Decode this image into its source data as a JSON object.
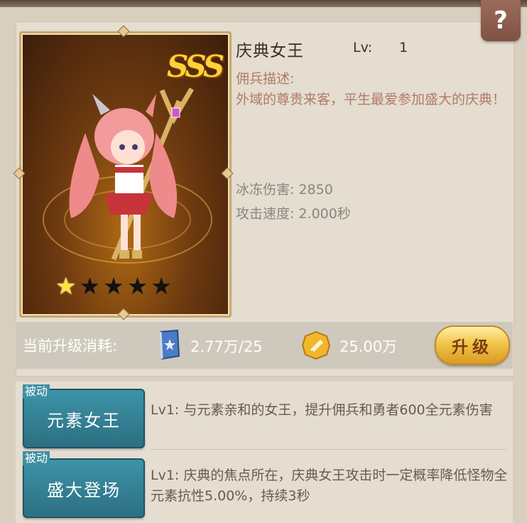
{
  "help_label": "?",
  "hero": {
    "name": "庆典女王",
    "level_label": "Lv:",
    "level_value": "1",
    "grade": "SSS",
    "stars_total": 5,
    "stars_filled": 1,
    "desc_title": "佣兵描述:",
    "desc_text": "外域的尊贵来客，平生最爱参加盛大的庆典！",
    "stats": [
      {
        "text": "冰冻伤害: 2850"
      },
      {
        "text": "攻击速度: 2.000秒"
      }
    ]
  },
  "cost": {
    "label": "当前升级消耗:",
    "book_amount": "2.77万/25",
    "gold_amount": "25.00万",
    "upgrade_label": "升级",
    "book_icon": "skill-book-icon",
    "coin_icon": "gold-coin-icon"
  },
  "skills": [
    {
      "tag": "被动",
      "name": "元素女王",
      "desc": "Lv1: 与元素亲和的女王，提升佣兵和勇者600全元素伤害"
    },
    {
      "tag": "被动",
      "name": "盛大登场",
      "desc": "Lv1: 庆典的焦点所在，庆典女王攻击时一定概率降低怪物全元素抗性5.00%，持续3秒"
    }
  ],
  "colors": {
    "desc_text": "#b07a6a",
    "stat_text": "#8a8580",
    "skill_button": "#2f7a8e",
    "upgrade_button": "#f2c44a"
  }
}
